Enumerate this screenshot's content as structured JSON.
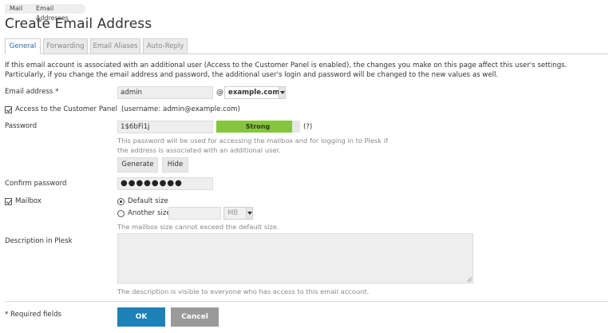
{
  "breadcrumb": [
    "Mail",
    "Email Addresses"
  ],
  "page_title": "Create Email Address",
  "tabs": [
    {
      "label": "General",
      "active": true
    },
    {
      "label": "Forwarding",
      "active": false
    },
    {
      "label": "Email Aliases",
      "active": false
    },
    {
      "label": "Auto-Reply",
      "active": false
    }
  ],
  "intro": "If this email account is associated with an additional user (Access to the Customer Panel is enabled), the changes you make on this page affect this user's settings. Particularly, if you change the email address and password, the additional user's login and password will be changed to the new values as well.",
  "email": {
    "label": "Email address *",
    "local_part": "admin",
    "at": "@",
    "domain": "example.com"
  },
  "customer_panel": {
    "checked": true,
    "label": "Access to the Customer Panel",
    "username_note": "(username: admin@example.com)"
  },
  "password": {
    "label": "Password",
    "value": "1$6bFi1j",
    "strength_label": "Strong",
    "strength_level": 0.9,
    "strength_color": "#86c53f",
    "help": "(?)",
    "hint": "This password will be used for accessing the mailbox and for logging in to Plesk if the address is associated with an additional user.",
    "generate_label": "Generate",
    "hide_label": "Hide"
  },
  "confirm_password": {
    "label": "Confirm password",
    "masked": "●●●●●●●●"
  },
  "mailbox": {
    "checked": true,
    "label": "Mailbox",
    "default_size_label": "Default size",
    "another_size_label": "Another size",
    "unit": "MB",
    "hint": "The mailbox size cannot exceed the default size."
  },
  "description": {
    "label": "Description in Plesk",
    "value": "",
    "hint": "The description is visible to everyone who has access to this email account."
  },
  "footer": {
    "required_note": "* Required fields",
    "ok_label": "OK",
    "cancel_label": "Cancel"
  },
  "colors": {
    "accent": "#1e81b7",
    "tab_active_text": "#2a6aa2",
    "cancel": "#9a9a9a"
  }
}
